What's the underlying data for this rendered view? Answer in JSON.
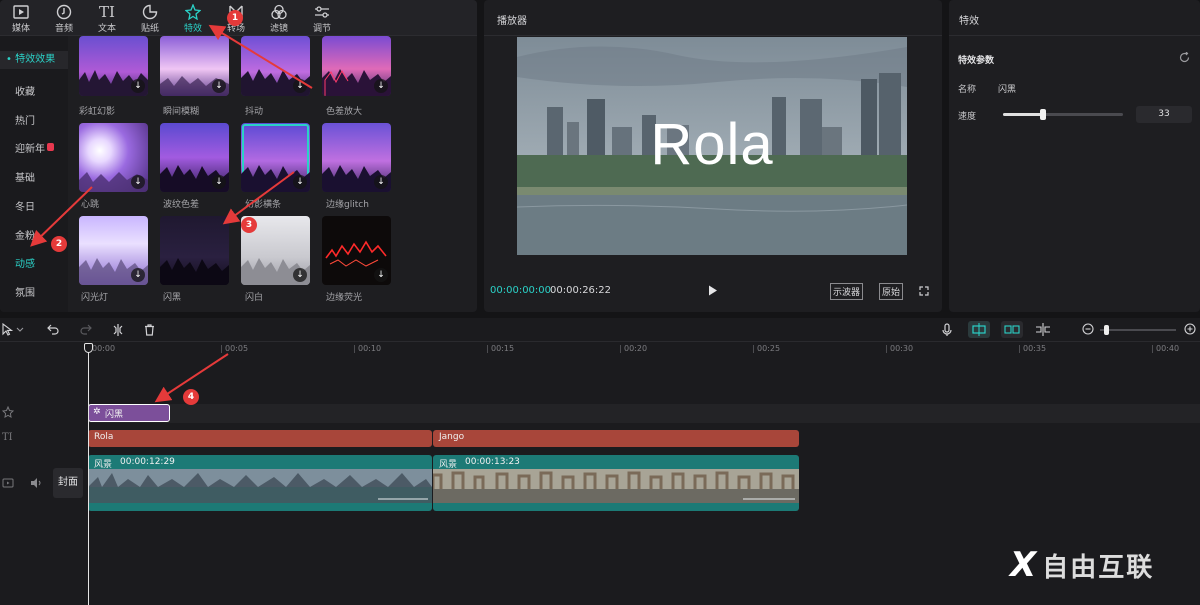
{
  "toolbar": {
    "tabs": [
      {
        "label": "媒体",
        "icon": "media-icon"
      },
      {
        "label": "音频",
        "icon": "audio-icon"
      },
      {
        "label": "文本",
        "icon": "text-icon"
      },
      {
        "label": "贴纸",
        "icon": "sticker-icon"
      },
      {
        "label": "特效",
        "icon": "effects-icon",
        "active": true
      },
      {
        "label": "转场",
        "icon": "transition-icon"
      },
      {
        "label": "滤镜",
        "icon": "filter-icon"
      },
      {
        "label": "调节",
        "icon": "adjust-icon"
      }
    ]
  },
  "categories": {
    "header": "特效效果",
    "items": [
      "收藏",
      "热门",
      "迎新年",
      "基础",
      "冬日",
      "金粉",
      "动感",
      "氛围"
    ],
    "active": "动感"
  },
  "effects": {
    "row1": [
      "彩虹幻影",
      "瞬间模糊",
      "抖动",
      "色差放大"
    ],
    "row2": [
      "心跳",
      "波纹色差",
      "幻影横条",
      "边缘glitch"
    ],
    "row3": [
      "闪光灯",
      "闪黑",
      "闪白",
      "边缘荧光"
    ],
    "download_glyph": "↓"
  },
  "player": {
    "title": "播放器",
    "video_text": "Rola",
    "current_time": "00:00:00:00",
    "duration": "00:00:26:22",
    "oscilloscope_label": "示波器",
    "original_label": "原始"
  },
  "inspector": {
    "title": "特效",
    "section": "特效参数",
    "name_label": "名称",
    "name_value": "闪黑",
    "speed_label": "速度",
    "speed_value": "33",
    "speed_fraction": 0.33
  },
  "timeline": {
    "ruler": [
      "00:00",
      "00:05",
      "00:10",
      "00:15",
      "00:20",
      "00:25",
      "00:30",
      "00:35",
      "00:40"
    ],
    "cover_label": "封面",
    "effect_clip": "闪黑",
    "text_clips": [
      "Rola",
      "Jango"
    ],
    "video_clips": [
      {
        "name": "风景",
        "duration": "00:00:12:29"
      },
      {
        "name": "风景",
        "duration": "00:00:13:23"
      }
    ]
  },
  "annotations": [
    "1",
    "2",
    "3",
    "4"
  ],
  "watermark": "自由互联",
  "colors": {
    "accent": "#2bd1c7",
    "text_clip": "#a8463a",
    "effect_clip": "#7c4f9a",
    "video_clip": "#1c7a76",
    "marker": "#e53a3a"
  }
}
